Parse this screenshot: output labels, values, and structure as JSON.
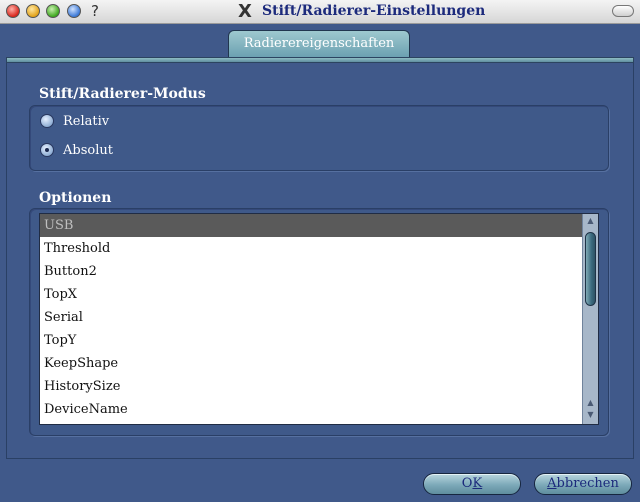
{
  "window": {
    "title": "Stift/Radierer-Einstellungen",
    "help_symbol": "?",
    "x_symbol": "X"
  },
  "tabs": [
    {
      "label": "Radierereigenschaften",
      "active": true
    }
  ],
  "mode_group": {
    "title": "Stift/Radierer-Modus",
    "options": [
      {
        "label": "Relativ",
        "checked": false
      },
      {
        "label": "Absolut",
        "checked": true
      }
    ]
  },
  "options_group": {
    "title": "Optionen",
    "items": [
      "USB",
      "Threshold",
      "Button2",
      "TopX",
      "Serial",
      "TopY",
      "KeepShape",
      "HistorySize",
      "DeviceName"
    ],
    "selected_index": 0
  },
  "buttons": {
    "ok_prefix": "O",
    "ok_mnemonic": "K",
    "cancel_mnemonic": "A",
    "cancel_rest": "bbrechen"
  },
  "colors": {
    "background": "#40598a",
    "title_text": "#1c2a7c",
    "selection": "#5a5a5a"
  }
}
